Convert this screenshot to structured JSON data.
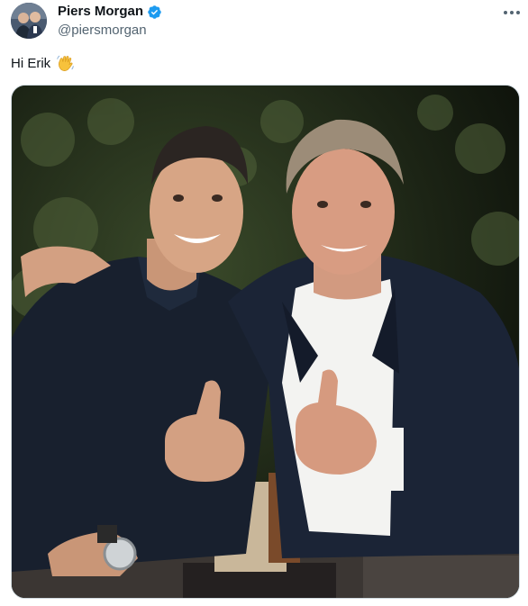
{
  "author": {
    "display_name": "Piers Morgan",
    "handle": "@piersmorgan",
    "verified": true
  },
  "tweet": {
    "text": "Hi Erik",
    "emoji": "waving-hand"
  },
  "media": {
    "description_icon": "photo"
  },
  "colors": {
    "verified_blue": "#1d9bf0",
    "secondary_text": "#536471",
    "border": "#cfd9de"
  }
}
